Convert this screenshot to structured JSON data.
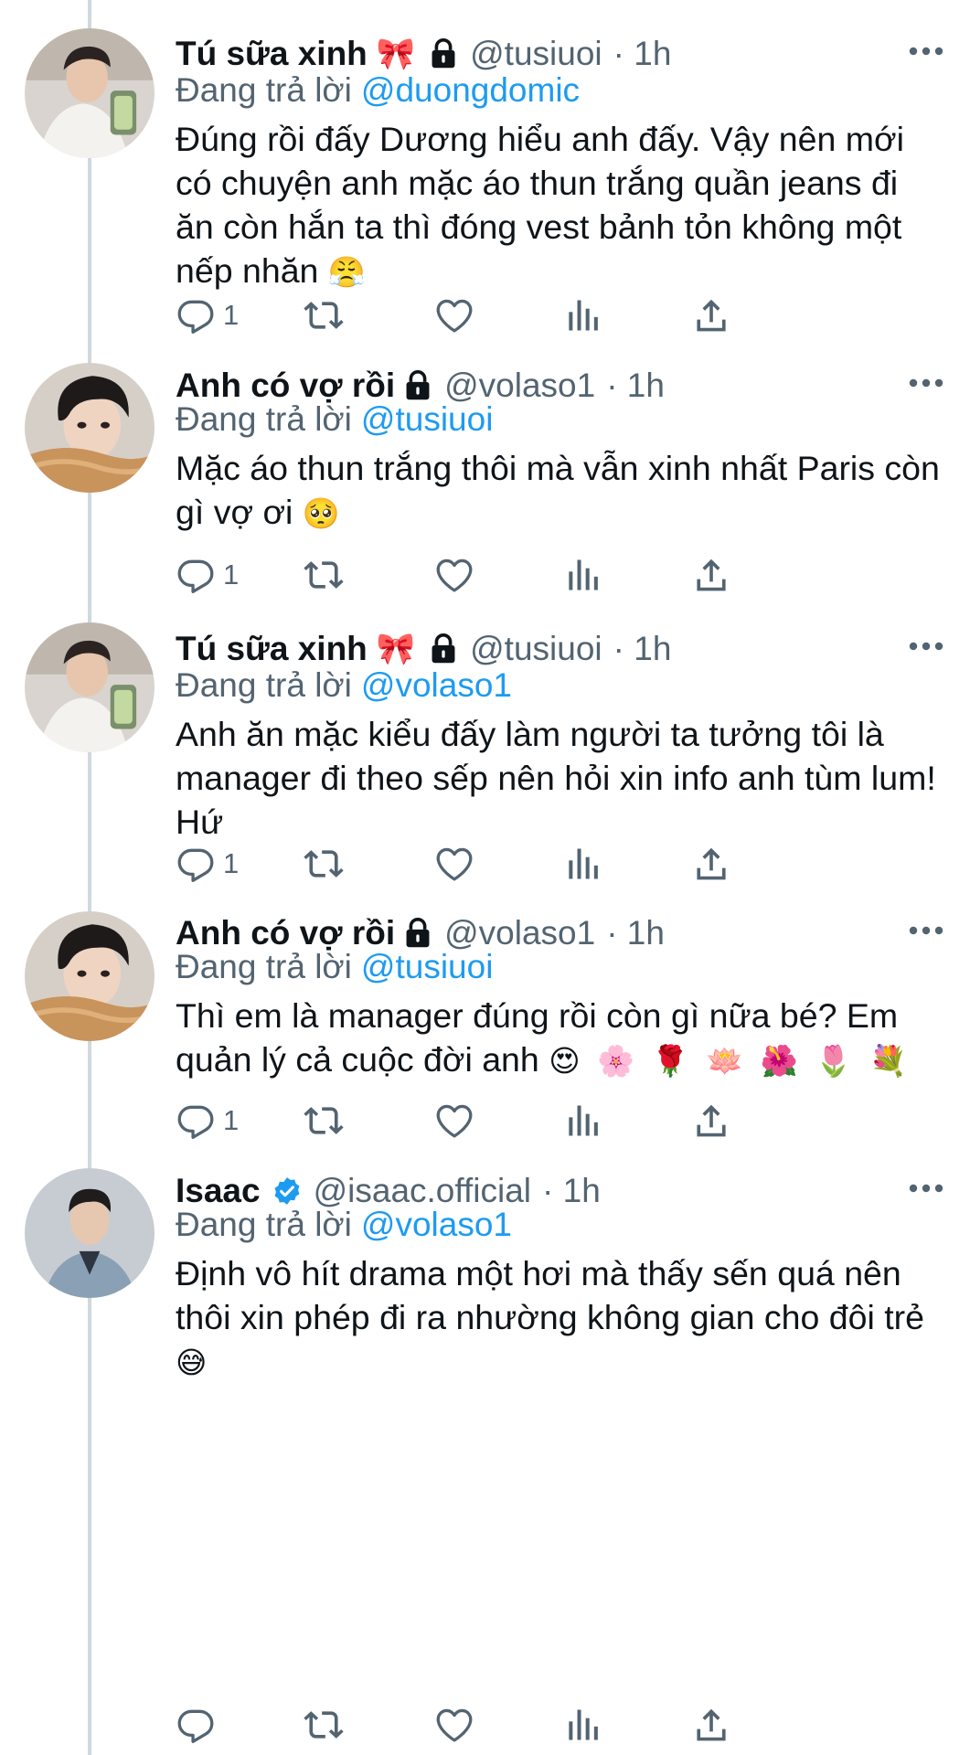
{
  "tweets": [
    {
      "name": "Tú sữa xinh",
      "name_emoji": "🎀",
      "handle": "@tusiuoi",
      "time": "· 1h",
      "replying_label": "Đang trả lời",
      "replying_to": "@duongdomic",
      "text": "Đúng rồi đấy Dương hiểu anh đấy. Vậy nên mới có chuyện anh mặc áo thun trắng quần jeans đi ăn còn hắn ta thì đóng vest bảnh tỏn không một nếp nhăn",
      "text_emoji": "😤",
      "reply_count": "1",
      "protected": true
    },
    {
      "name": "Anh có vợ rồi",
      "handle": "@volaso1",
      "time": "· 1h",
      "replying_label": "Đang trả lời",
      "replying_to": "@tusiuoi",
      "text": "Mặc áo thun trắng thôi mà vẫn xinh nhất Paris còn gì vợ ơi",
      "text_emoji": "🥺",
      "reply_count": "1",
      "protected": true
    },
    {
      "name": "Tú sữa xinh",
      "name_emoji": "🎀",
      "handle": "@tusiuoi",
      "time": "· 1h",
      "replying_label": "Đang trả lời",
      "replying_to": "@volaso1",
      "text": "Anh ăn mặc kiểu đấy làm người ta tưởng tôi là manager đi theo sếp nên hỏi xin info anh tùm lum! Hứ",
      "reply_count": "1",
      "protected": true
    },
    {
      "name": "Anh có vợ rồi",
      "handle": "@volaso1",
      "time": "· 1h",
      "replying_label": "Đang trả lời",
      "replying_to": "@tusiuoi",
      "text": "Thì em là manager đúng rồi còn gì nữa bé? Em quản lý cả cuộc đời anh",
      "text_emoji": "😍 🌸 🌹 🪷 🌺 🌷 💐",
      "reply_count": "1",
      "protected": true
    },
    {
      "name": "Isaac",
      "handle": "@isaac.official",
      "time": "· 1h",
      "replying_label": "Đang trả lời",
      "replying_to": "@volaso1",
      "text": "Định vô hít drama một hơi mà thấy sến quá nên thôi xin phép đi ra nhường không gian cho đôi trẻ",
      "text_emoji": "😅",
      "reply_count": "",
      "verified": true
    }
  ],
  "icons": {
    "reply": "reply-icon",
    "retweet": "retweet-icon",
    "like": "heart-icon",
    "views": "analytics-icon",
    "share": "share-icon",
    "more": "more-icon",
    "lock": "lock-icon",
    "verified": "verified-badge-icon"
  },
  "colors": {
    "text": "#0f1419",
    "secondary": "#536471",
    "link": "#1d9bf0",
    "thread_line": "#cfd9de"
  }
}
